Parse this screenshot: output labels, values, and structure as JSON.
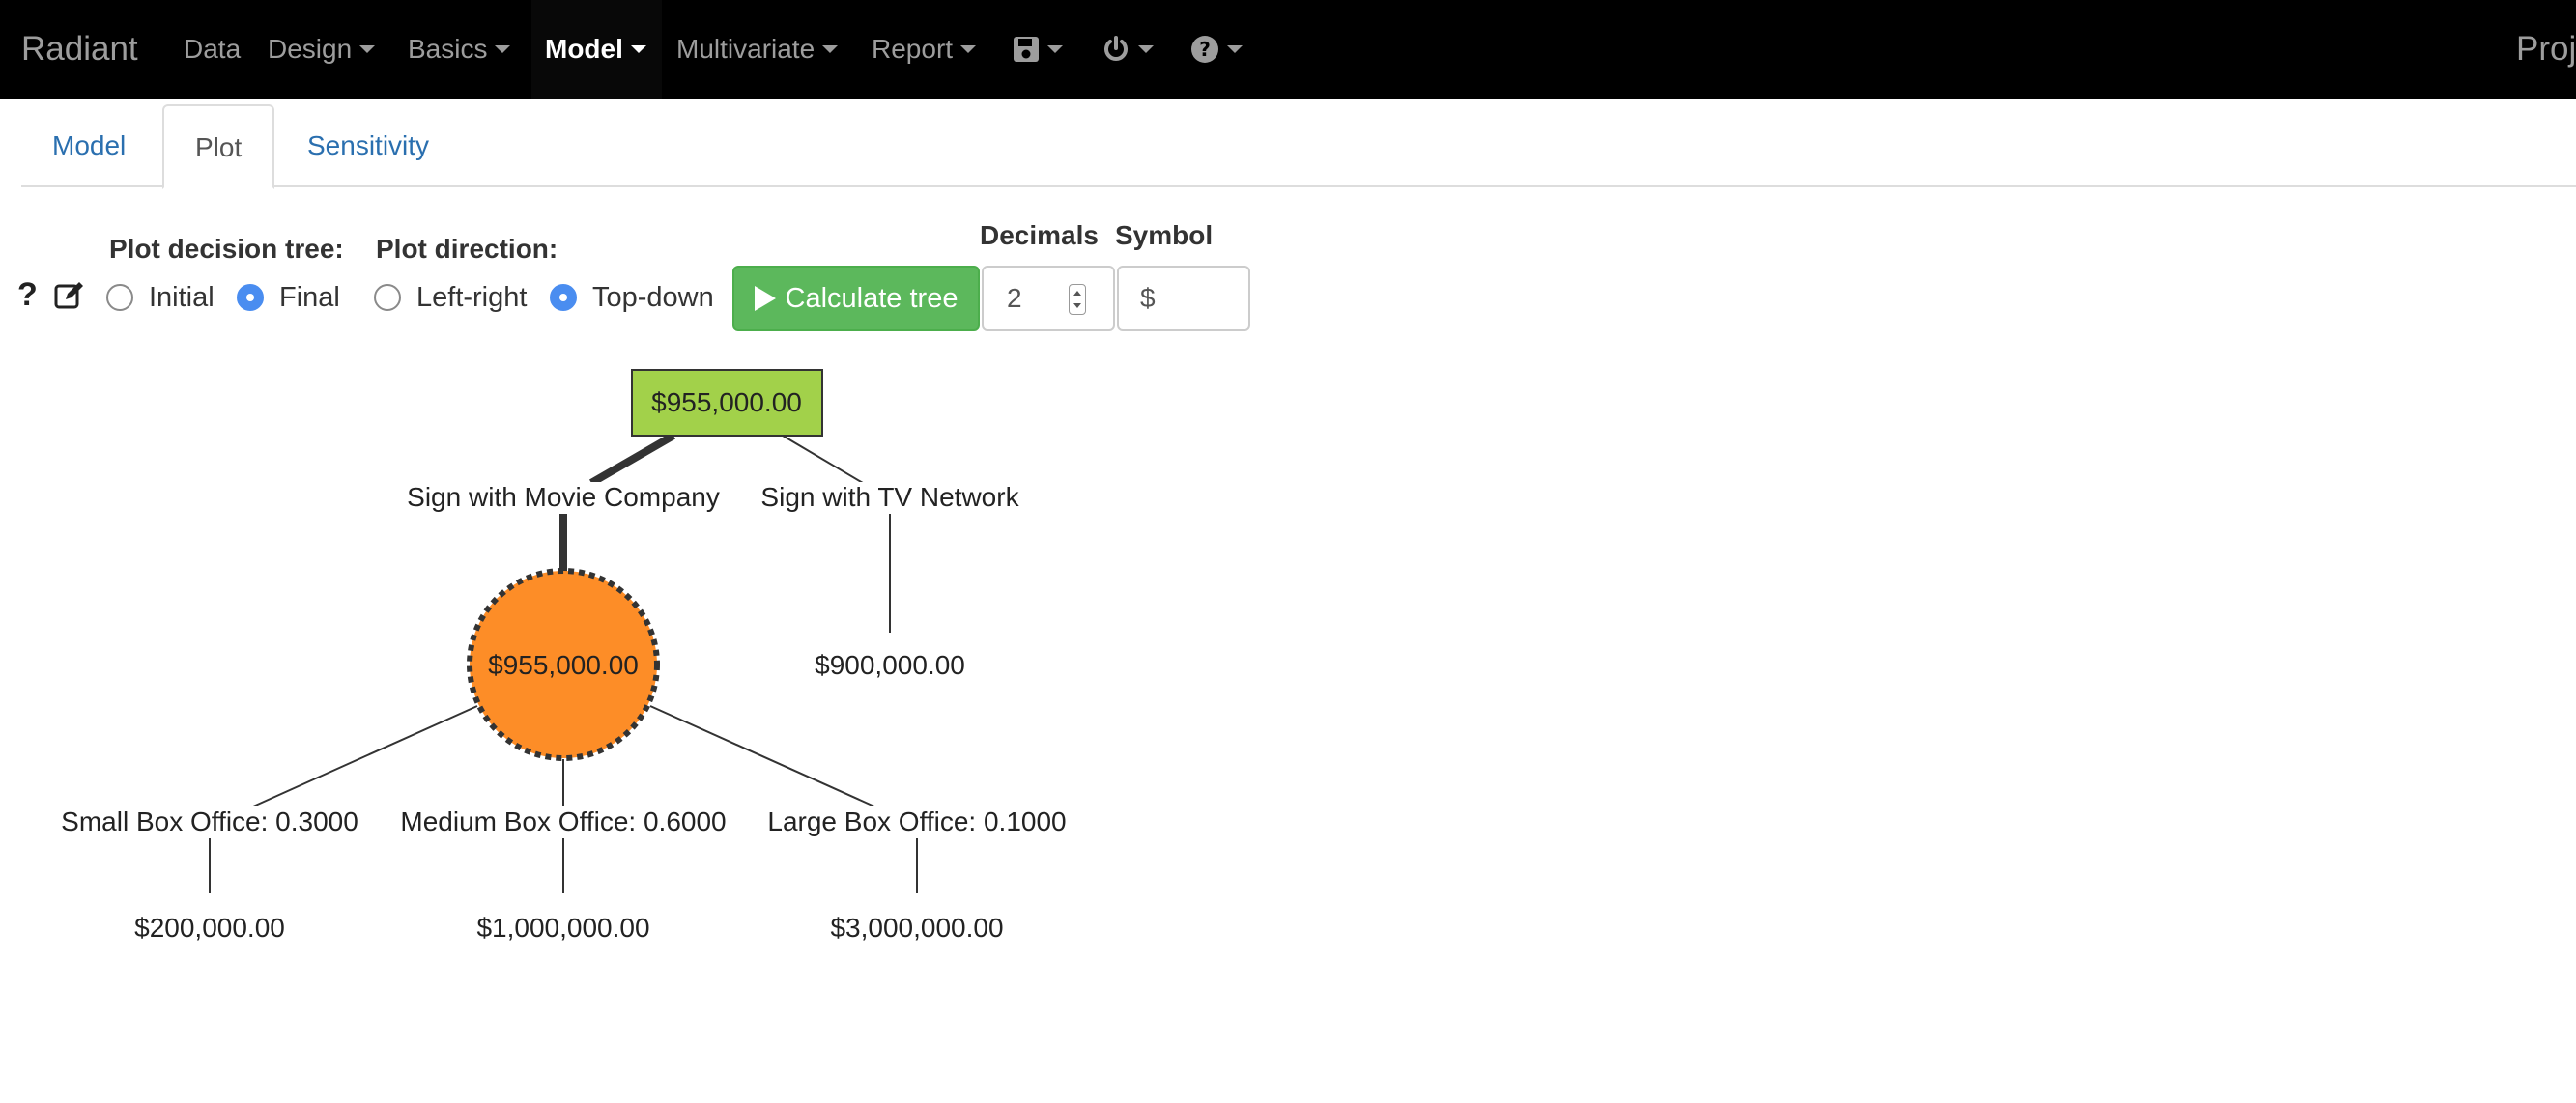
{
  "navbar": {
    "brand": "Radiant",
    "items": [
      {
        "label": "Data",
        "dropdown": false
      },
      {
        "label": "Design",
        "dropdown": true
      },
      {
        "label": "Basics",
        "dropdown": true
      },
      {
        "label": "Model",
        "dropdown": true,
        "active": true
      },
      {
        "label": "Multivariate",
        "dropdown": true
      },
      {
        "label": "Report",
        "dropdown": true
      }
    ],
    "icon_menus": [
      "save-icon",
      "power-icon",
      "question-circle-icon"
    ],
    "right_text": "Proj"
  },
  "tabs": [
    {
      "label": "Model",
      "active": false
    },
    {
      "label": "Plot",
      "active": true
    },
    {
      "label": "Sensitivity",
      "active": false
    }
  ],
  "controls": {
    "plot_tree_label": "Plot decision tree:",
    "plot_tree_options": [
      {
        "label": "Initial",
        "checked": false
      },
      {
        "label": "Final",
        "checked": true
      }
    ],
    "direction_label": "Plot direction:",
    "direction_options": [
      {
        "label": "Left-right",
        "checked": false
      },
      {
        "label": "Top-down",
        "checked": true
      }
    ],
    "calculate_label": "Calculate tree",
    "decimals_label": "Decimals",
    "decimals_value": "2",
    "symbol_label": "Symbol",
    "symbol_value": "$"
  },
  "tree": {
    "decision_node": {
      "value": "$955,000.00",
      "color": "#a2d14a"
    },
    "branches": {
      "movie": "Sign with Movie Company",
      "tv": "Sign with TV Network"
    },
    "chance_node": {
      "value": "$955,000.00",
      "color": "#fd8d27"
    },
    "tv_payoff": "$900,000.00",
    "outcomes": [
      {
        "label": "Small Box Office: 0.3000",
        "payoff": "$200,000.00"
      },
      {
        "label": "Medium Box Office: 0.6000",
        "payoff": "$1,000,000.00"
      },
      {
        "label": "Large Box Office: 0.1000",
        "payoff": "$3,000,000.00"
      }
    ]
  },
  "colors": {
    "navbar_bg": "#000000",
    "nav_text": "#9d9d9d",
    "tab_link": "#2a6faf",
    "button_green": "#5cb85c",
    "radio_checked": "#4a8df0"
  }
}
